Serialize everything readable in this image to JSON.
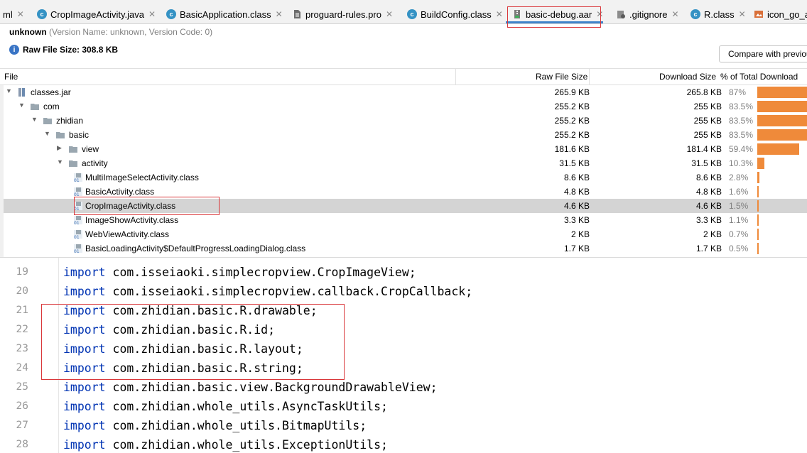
{
  "tabs": [
    {
      "label": "ml",
      "icon": "none"
    },
    {
      "label": "CropImageActivity.java",
      "icon": "class-icon"
    },
    {
      "label": "BasicApplication.class",
      "icon": "class-icon"
    },
    {
      "label": "proguard-rules.pro",
      "icon": "file-icon"
    },
    {
      "label": "BuildConfig.class",
      "icon": "class-icon"
    },
    {
      "label": "basic-debug.aar",
      "icon": "archive-icon"
    },
    {
      "label": ".gitignore",
      "icon": "gitignore-icon"
    },
    {
      "label": "R.class",
      "icon": "class-icon"
    },
    {
      "label": "icon_go_a",
      "icon": "image-icon"
    }
  ],
  "active_tab": "basic-debug.aar",
  "info": {
    "name": "unknown",
    "version": "(Version Name: unknown, Version Code: 0)",
    "raw_size_label": "Raw File Size: 308.8 KB"
  },
  "compare_button": "Compare with previous",
  "columns": {
    "file": "File",
    "raw": "Raw File Size",
    "download": "Download Size",
    "percent": "% of Total Download"
  },
  "rows": [
    {
      "name": "classes.jar",
      "raw": "265.9 KB",
      "download": "265.8 KB",
      "pct": "87%",
      "share": 87,
      "depth": 0,
      "expanded": true,
      "kind": "jar"
    },
    {
      "name": "com",
      "raw": "255.2 KB",
      "download": "255 KB",
      "pct": "83.5%",
      "share": 83.5,
      "depth": 1,
      "expanded": true,
      "kind": "folder"
    },
    {
      "name": "zhidian",
      "raw": "255.2 KB",
      "download": "255 KB",
      "pct": "83.5%",
      "share": 83.5,
      "depth": 2,
      "expanded": true,
      "kind": "folder"
    },
    {
      "name": "basic",
      "raw": "255.2 KB",
      "download": "255 KB",
      "pct": "83.5%",
      "share": 83.5,
      "depth": 3,
      "expanded": true,
      "kind": "folder"
    },
    {
      "name": "view",
      "raw": "181.6 KB",
      "download": "181.4 KB",
      "pct": "59.4%",
      "share": 59.4,
      "depth": 4,
      "expanded": false,
      "kind": "folder"
    },
    {
      "name": "activity",
      "raw": "31.5 KB",
      "download": "31.5 KB",
      "pct": "10.3%",
      "share": 10.3,
      "depth": 4,
      "expanded": true,
      "kind": "folder"
    },
    {
      "name": "MultiImageSelectActivity.class",
      "raw": "8.6 KB",
      "download": "8.6 KB",
      "pct": "2.8%",
      "share": 2.8,
      "depth": 5,
      "kind": "class"
    },
    {
      "name": "BasicActivity.class",
      "raw": "4.8 KB",
      "download": "4.8 KB",
      "pct": "1.6%",
      "share": 1.6,
      "depth": 5,
      "kind": "class"
    },
    {
      "name": "CropImageActivity.class",
      "raw": "4.6 KB",
      "download": "4.6 KB",
      "pct": "1.5%",
      "share": 1.5,
      "depth": 5,
      "kind": "class",
      "selected": true
    },
    {
      "name": "ImageShowActivity.class",
      "raw": "3.3 KB",
      "download": "3.3 KB",
      "pct": "1.1%",
      "share": 1.1,
      "depth": 5,
      "kind": "class"
    },
    {
      "name": "WebViewActivity.class",
      "raw": "2 KB",
      "download": "2 KB",
      "pct": "0.7%",
      "share": 0.7,
      "depth": 5,
      "kind": "class"
    },
    {
      "name": "BasicLoadingActivity$DefaultProgressLoadingDialog.class",
      "raw": "1.7 KB",
      "download": "1.7 KB",
      "pct": "0.5%",
      "share": 0.5,
      "depth": 5,
      "kind": "class"
    }
  ],
  "code_lines": [
    {
      "n": "19",
      "kw": "import",
      "rest": " com.isseiaoki.simplecropview.CropImageView;"
    },
    {
      "n": "20",
      "kw": "import",
      "rest": " com.isseiaoki.simplecropview.callback.CropCallback;"
    },
    {
      "n": "21",
      "kw": "import",
      "rest": " com.zhidian.basic.R.drawable;"
    },
    {
      "n": "22",
      "kw": "import",
      "rest": " com.zhidian.basic.R.id;"
    },
    {
      "n": "23",
      "kw": "import",
      "rest": " com.zhidian.basic.R.layout;"
    },
    {
      "n": "24",
      "kw": "import",
      "rest": " com.zhidian.basic.R.string;"
    },
    {
      "n": "25",
      "kw": "import",
      "rest": " com.zhidian.basic.view.BackgroundDrawableView;"
    },
    {
      "n": "26",
      "kw": "import",
      "rest": " com.zhidian.whole_utils.AsyncTaskUtils;"
    },
    {
      "n": "27",
      "kw": "import",
      "rest": " com.zhidian.whole_utils.BitmapUtils;"
    },
    {
      "n": "28",
      "kw": "import",
      "rest": " com.zhidian.whole_utils.ExceptionUtils;"
    }
  ],
  "colors": {
    "bar": "#ef8a3a",
    "keyword": "#0033b3",
    "highlight": "#d9373a",
    "tab_active": "#4083c9"
  }
}
